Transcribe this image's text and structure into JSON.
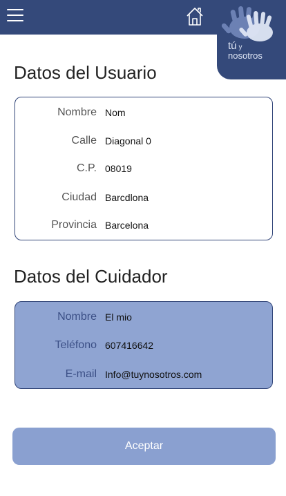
{
  "header": {
    "menu_icon": "hamburger-menu-icon",
    "home_icon": "home-icon",
    "logo": {
      "line1": "tú",
      "y": "y",
      "line2": "nosotros"
    }
  },
  "user_section": {
    "title": "Datos del Usuario",
    "fields": [
      {
        "label": "Nombre",
        "value": "Nom"
      },
      {
        "label": "Calle",
        "value": "Diagonal 0"
      },
      {
        "label": "C.P.",
        "value": "08019"
      },
      {
        "label": "Ciudad",
        "value": "Barcdlona"
      },
      {
        "label": "Provincia",
        "value": "Barcelona"
      }
    ]
  },
  "carer_section": {
    "title": "Datos del Cuidador",
    "fields": [
      {
        "label": "Nombre",
        "value": "El mio"
      },
      {
        "label": "Teléfono",
        "value": "607416642"
      },
      {
        "label": "E-mail",
        "value": "Info@tuynosotros.com"
      }
    ]
  },
  "accept_button": {
    "label": "Aceptar"
  },
  "colors": {
    "header": "#34497a",
    "card_border": "#2f4377",
    "carer_card_bg": "#8fa4d2",
    "button_bg": "#8aa0d0"
  }
}
